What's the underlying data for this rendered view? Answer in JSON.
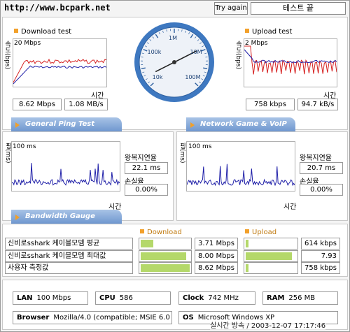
{
  "header": {
    "url": "http://www.bcpark.net",
    "try_again": "Try again",
    "status": "테스트 끝"
  },
  "download": {
    "title": "Download test",
    "ylabel": "속도(bps)",
    "scale": "20 Mbps",
    "xlabel": "시간",
    "value1": "8.62 Mbps",
    "value2": "1.08 MB/s"
  },
  "upload": {
    "title": "Upload test",
    "ylabel": "속도(bps)",
    "scale": "2 Mbps",
    "xlabel": "시간",
    "value1": "758 kbps",
    "value2": "94.7 kB/s"
  },
  "gauge": {
    "ticks": [
      "10k",
      "100k",
      "1M",
      "10M",
      "100M"
    ],
    "needle_value": "8.62 Mbps"
  },
  "sections": {
    "ping": "General Ping Test",
    "game": "Network Game & VoIP Test",
    "bandwidth": "Bandwidth Gauge"
  },
  "ping": {
    "ylabel": "핑(ms)",
    "scale": "100 ms",
    "xlabel": "시간",
    "latency_label": "왕복지연율",
    "latency": "22.1 ms",
    "loss_label": "손실율",
    "loss": "0.00%"
  },
  "game": {
    "ylabel": "핑(ms)",
    "scale": "100 ms",
    "xlabel": "시간",
    "latency_label": "왕복지연율",
    "latency": "20.7 ms",
    "loss_label": "손실율",
    "loss": "0.00%"
  },
  "bandwidth": {
    "download_label": "Download",
    "upload_label": "Upload",
    "rows": [
      {
        "label": "신비로sshark 케이블모뎀 평균",
        "down": "3.71 Mbps",
        "down_fill": 0.26,
        "up": "614 kbps",
        "up_fill": 0.05
      },
      {
        "label": "신비로sshark 케이블모뎀 최대값",
        "down": "8.00 Mbps",
        "down_fill": 0.93,
        "up": "7.93 Mbps",
        "up_fill": 0.92
      },
      {
        "label": "사용자 측정값",
        "down": "8.62 Mbps",
        "down_fill": 1.0,
        "up": "758 kbps",
        "up_fill": 0.06
      }
    ]
  },
  "system": {
    "lan_label": "LAN",
    "lan": "100 Mbps",
    "cpu_label": "CPU",
    "cpu": "586",
    "clock_label": "Clock",
    "clock": "742 MHz",
    "ram_label": "RAM",
    "ram": "256 MB",
    "browser_label": "Browser",
    "browser": "Mozilla/4.0 (compatible; MSIE 6.0",
    "os_label": "OS",
    "os": "Microsoft Windows XP",
    "timestamp": "실시간 방속 / 2003-12-07 17:17:46"
  },
  "colors": {
    "accent": "#f2a02a",
    "band": "#6f97cf",
    "bar_fill": "#b4d86a",
    "line_blue": "#1f1fa8",
    "line_red": "#d62020"
  }
}
